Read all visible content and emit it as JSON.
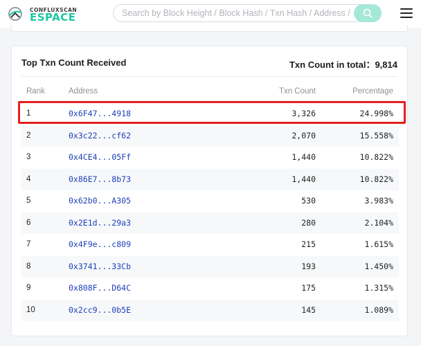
{
  "header": {
    "logo_top": "CONFLUXSCAN",
    "logo_bottom": "ESPACE",
    "search_placeholder": "Search by Block Height / Block Hash / Txn Hash / Address / Token",
    "icons": {
      "search": "search-icon",
      "menu": "hamburger-menu-icon",
      "logo": "confluxscan-logo-icon"
    }
  },
  "card": {
    "title": "Top Txn Count Received",
    "total_label": "Txn Count in total：",
    "total_value": "9,814"
  },
  "table": {
    "columns": {
      "rank": "Rank",
      "address": "Address",
      "count": "Txn Count",
      "percentage": "Percentage"
    },
    "rows": [
      {
        "rank": "1",
        "address": "0x6F47...4918",
        "count": "3,326",
        "percentage": "24.998%"
      },
      {
        "rank": "2",
        "address": "0x3c22...cf62",
        "count": "2,070",
        "percentage": "15.558%"
      },
      {
        "rank": "3",
        "address": "0x4CE4...05Ff",
        "count": "1,440",
        "percentage": "10.822%"
      },
      {
        "rank": "4",
        "address": "0x86E7...8b73",
        "count": "1,440",
        "percentage": "10.822%"
      },
      {
        "rank": "5",
        "address": "0x62b0...A305",
        "count": "530",
        "percentage": "3.983%"
      },
      {
        "rank": "6",
        "address": "0x2E1d...29a3",
        "count": "280",
        "percentage": "2.104%"
      },
      {
        "rank": "7",
        "address": "0x4F9e...c809",
        "count": "215",
        "percentage": "1.615%"
      },
      {
        "rank": "8",
        "address": "0x3741...33Cb",
        "count": "193",
        "percentage": "1.450%"
      },
      {
        "rank": "9",
        "address": "0x808F...D64C",
        "count": "175",
        "percentage": "1.315%"
      },
      {
        "rank": "10",
        "address": "0x2cc9...0b5E",
        "count": "145",
        "percentage": "1.089%"
      }
    ]
  },
  "colors": {
    "accent": "#1bc7a3",
    "address_link": "#1e3fb8",
    "highlight_border": "#e41e1e",
    "search_button": "#a6e8d7"
  }
}
